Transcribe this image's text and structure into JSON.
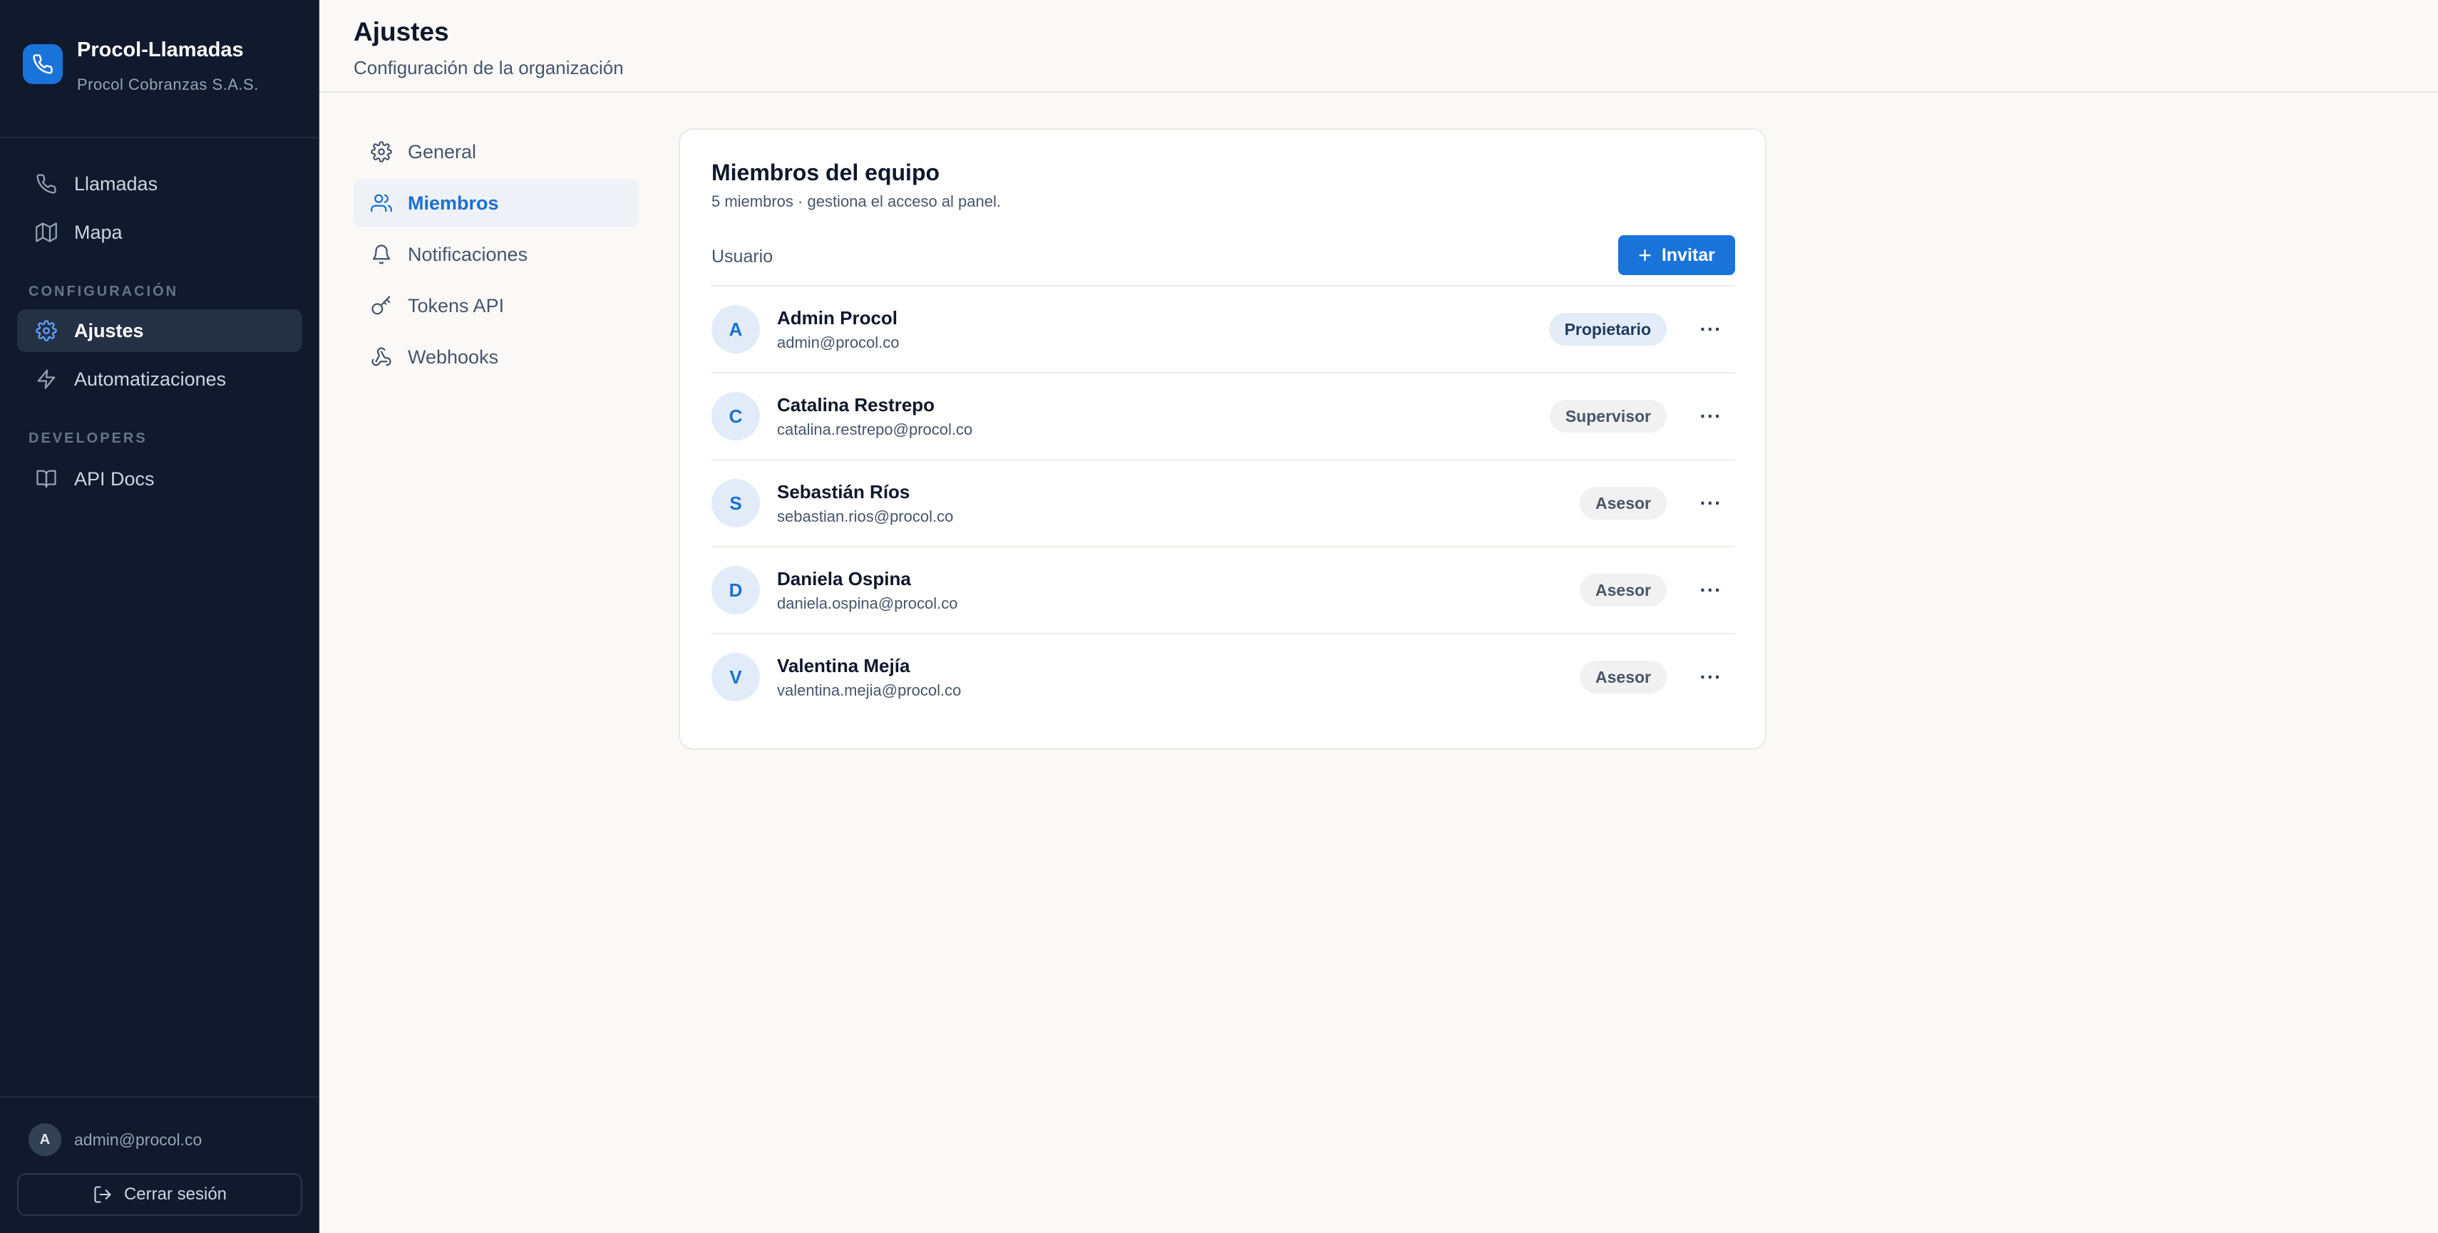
{
  "app": {
    "name": "Procol-Llamadas",
    "org": "Procol Cobranzas S.A.S."
  },
  "sidebar": {
    "items": [
      {
        "label": "Llamadas",
        "icon": "phone-icon"
      },
      {
        "label": "Mapa",
        "icon": "map-icon"
      }
    ],
    "config_label": "CONFIGURACIÓN",
    "config_items": [
      {
        "label": "Ajustes",
        "icon": "gear-icon",
        "active": true
      },
      {
        "label": "Automatizaciones",
        "icon": "bolt-icon"
      }
    ],
    "dev_label": "DEVELOPERS",
    "dev_items": [
      {
        "label": "API Docs",
        "icon": "book-icon"
      }
    ],
    "user": {
      "initial": "A",
      "email": "admin@procol.co"
    },
    "logout_label": "Cerrar sesión"
  },
  "header": {
    "title": "Ajustes",
    "subtitle": "Configuración de la organización"
  },
  "settings_nav": [
    {
      "label": "General",
      "icon": "gear-icon"
    },
    {
      "label": "Miembros",
      "icon": "users-icon",
      "active": true
    },
    {
      "label": "Notificaciones",
      "icon": "bell-icon"
    },
    {
      "label": "Tokens API",
      "icon": "key-icon"
    },
    {
      "label": "Webhooks",
      "icon": "webhook-icon"
    }
  ],
  "members_card": {
    "title": "Miembros del equipo",
    "subtitle": "5 miembros · gestiona el acceso al panel.",
    "column_user": "Usuario",
    "invite_label": "Invitar",
    "members": [
      {
        "initial": "A",
        "name": "Admin Procol",
        "email": "admin@procol.co",
        "role": "Propietario"
      },
      {
        "initial": "C",
        "name": "Catalina Restrepo",
        "email": "catalina.restrepo@procol.co",
        "role": "Supervisor"
      },
      {
        "initial": "S",
        "name": "Sebastián Ríos",
        "email": "sebastian.rios@procol.co",
        "role": "Asesor"
      },
      {
        "initial": "D",
        "name": "Daniela Ospina",
        "email": "daniela.ospina@procol.co",
        "role": "Asesor"
      },
      {
        "initial": "V",
        "name": "Valentina Mejía",
        "email": "valentina.mejia@procol.co",
        "role": "Asesor"
      }
    ]
  },
  "colors": {
    "sidebar_bg": "#101a2c",
    "accent": "#1a73d9",
    "page_bg": "#faf9f7"
  }
}
